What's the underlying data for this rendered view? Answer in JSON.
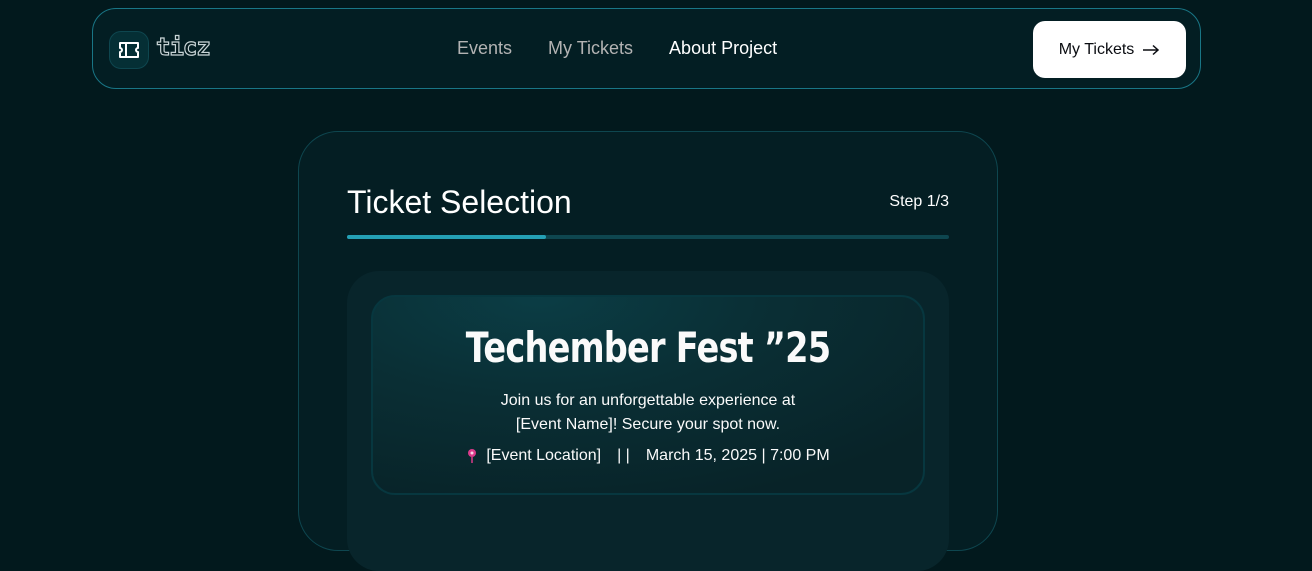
{
  "navbar": {
    "logo_text": "ticz",
    "logo_icon": "ticket-icon",
    "links": [
      "Events",
      "My Tickets",
      "About Project"
    ],
    "active_link": "About Project",
    "cta_label": "My Tickets",
    "cta_icon": "arrow-right-icon"
  },
  "card": {
    "title": "Ticket Selection",
    "step": "Step 1/3",
    "progress": 0.33
  },
  "event": {
    "name": "Techember Fest ”25",
    "description_line1": "Join us for an unforgettable experience at",
    "description_line2": "[Event Name]! Secure your spot now.",
    "location_icon": "location-pin-icon",
    "location": "[Event Location]",
    "separator": "| |",
    "datetime": "March 15, 2025 | 7:00 PM"
  },
  "colors": {
    "background": "#02191d",
    "border": "#197686",
    "accent": "#24a0b5",
    "pin": "#db3a8b"
  }
}
